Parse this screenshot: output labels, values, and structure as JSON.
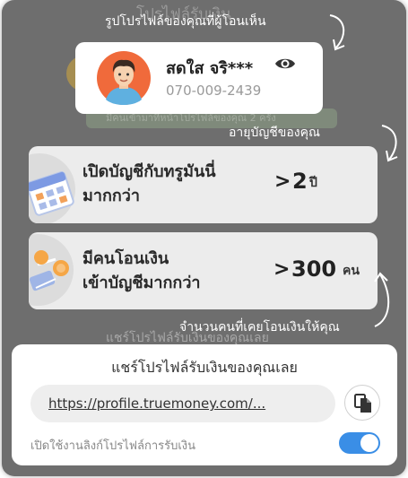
{
  "background": {
    "faded_title": "โปรไฟล์รับเงิน",
    "faded_note": "มีคนเข้ามาที่หน้าโปรไฟล์ของคุณ 2 ครั้ง",
    "faded_share_title": "แชร์โปรไฟล์รับเงินของคุณเลย"
  },
  "annotations": {
    "profile_hint": "รูปโปรไฟล์ของคุณที่ผู้โอนเห็น",
    "account_age_hint": "อายุบัญชีของคุณ",
    "transfer_count_hint": "จำนวนคนที่เคยโอนเงินให้คุณ"
  },
  "profile": {
    "name": "สดใส จริ***",
    "phone": "070-009-2439"
  },
  "stats": {
    "account_age": {
      "line1": "เปิดบัญชีกับทรูมันนี่",
      "line2": "มากกว่า",
      "prefix": ">",
      "value": "2",
      "unit": "ปี"
    },
    "transfers": {
      "line1": "มีคนโอนเงิน",
      "line2": "เข้าบัญชีมากกว่า",
      "prefix": ">",
      "value": "300",
      "unit": "คน"
    }
  },
  "share": {
    "title": "แชร์โปรไฟล์รับเงินของคุณเลย",
    "url": "https://profile.truemoney.com/...",
    "toggle_label": "เปิดใช้งานลิงก์โปรไฟล์การรับเงิน",
    "toggle_on": true
  },
  "colors": {
    "overlay": "#6e6e6e",
    "card": "#ececec",
    "toggle_on": "#3a8ee6"
  }
}
